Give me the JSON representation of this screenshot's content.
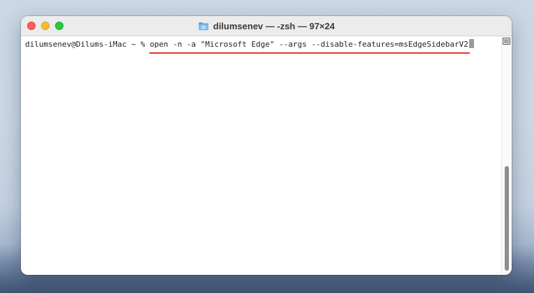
{
  "window": {
    "title": "dilumsenev — -zsh — 97×24",
    "folder_icon": "folder-icon",
    "folder_color": "#5fa8e6"
  },
  "terminal": {
    "prompt": "dilumsenev@Dilums-iMac ~ % ",
    "command": "open -n -a \"Microsoft Edge\" --args --disable-features=msEdgeSidebarV2",
    "highlight_color": "#e3342f"
  },
  "traffic_lights": {
    "close_color": "#ff5f57",
    "minimize_color": "#febc2e",
    "zoom_color": "#28c840"
  }
}
